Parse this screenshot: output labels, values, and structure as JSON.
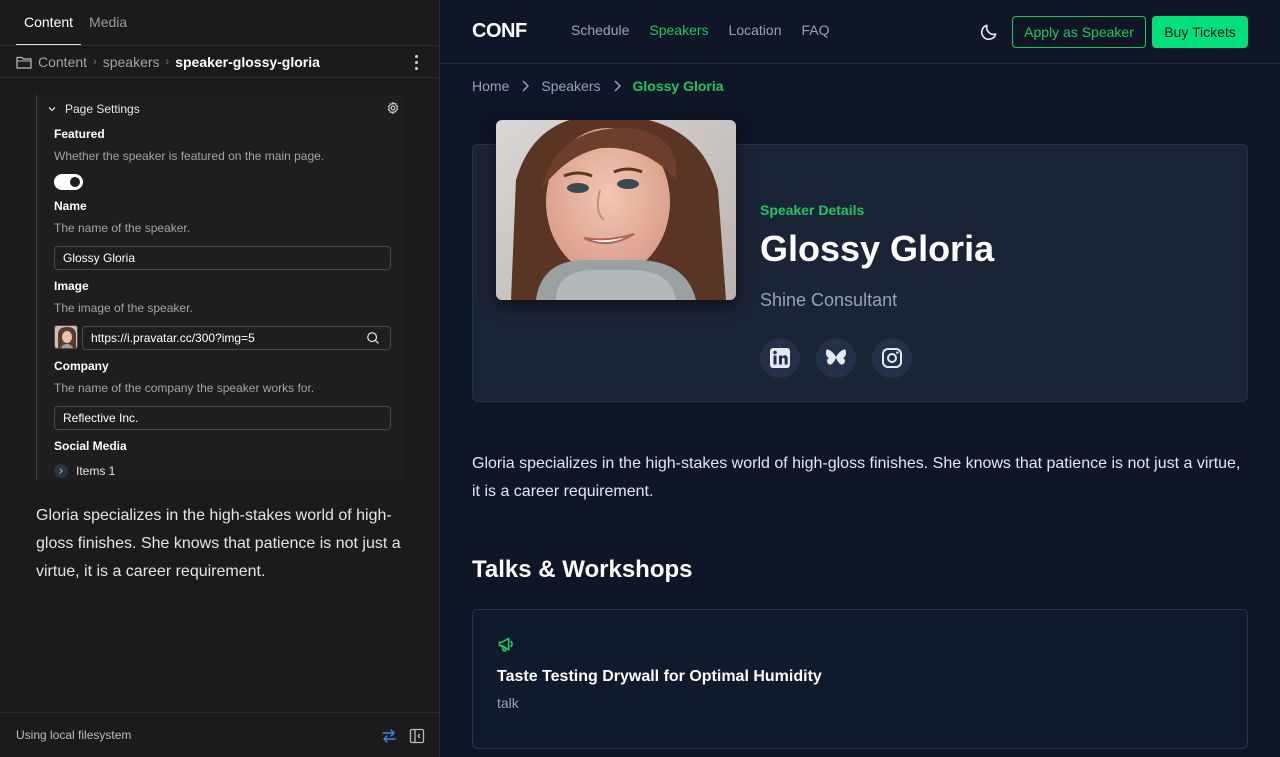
{
  "cms": {
    "tabs": [
      "Content",
      "Media"
    ],
    "breadcrumb": {
      "root": "Content",
      "folder": "speakers",
      "current": "speaker-glossy-gloria"
    },
    "settings_title": "Page Settings",
    "fields": {
      "featured": {
        "label": "Featured",
        "description": "Whether the speaker is featured on the main page.",
        "value": true
      },
      "name": {
        "label": "Name",
        "description": "The name of the speaker.",
        "value": "Glossy Gloria"
      },
      "image": {
        "label": "Image",
        "description": "The image of the speaker.",
        "value": "https://i.pravatar.cc/300?img=5"
      },
      "company": {
        "label": "Company",
        "description": "The name of the company the speaker works for.",
        "value": "Reflective Inc."
      },
      "social_media": {
        "label": "Social Media",
        "items_label": "Items 1"
      }
    },
    "body_text": "Gloria specializes in the high-stakes world of high-gloss finishes. She knows that patience is not just a virtue, it is a career requirement.",
    "footer_status": "Using local filesystem"
  },
  "site": {
    "logo": "CONF",
    "nav": [
      "Schedule",
      "Speakers",
      "Location",
      "FAQ"
    ],
    "active_nav": "Speakers",
    "apply_button": "Apply as Speaker",
    "buy_button": "Buy Tickets",
    "breadcrumb": [
      "Home",
      "Speakers",
      "Glossy Gloria"
    ],
    "speaker": {
      "eyebrow": "Speaker Details",
      "name": "Glossy Gloria",
      "company": "Shine Consultant",
      "socials": [
        "linkedin-icon",
        "bluesky-icon",
        "instagram-icon"
      ]
    },
    "bio": "Gloria specializes in the high-stakes world of high-gloss finishes. She knows that patience is not just a virtue, it is a career requirement.",
    "talks_heading": "Talks & Workshops",
    "talks": [
      {
        "title": "Taste Testing Drywall for Optimal Humidity",
        "type": "talk"
      }
    ],
    "colors": {
      "accent": "#22c55e",
      "cta": "#00e07a",
      "background": "#0e1628",
      "card": "#1a2436"
    }
  }
}
